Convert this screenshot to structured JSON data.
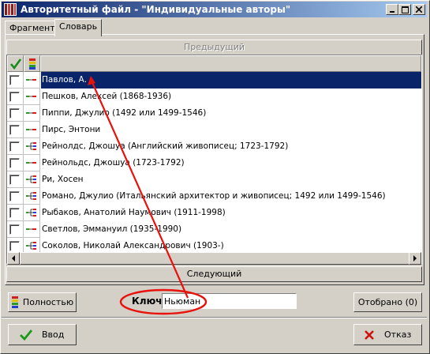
{
  "window": {
    "title": "Авторитетный файл - \"Индивидуальные авторы\""
  },
  "tabs": [
    {
      "label": "Фрагмент",
      "active": false
    },
    {
      "label": "Словарь",
      "active": true
    }
  ],
  "nav": {
    "previous_label": "Предыдущий",
    "next_label": "Следующий"
  },
  "list": {
    "items": [
      {
        "name": "Павлов, А.",
        "icon": "single",
        "selected": true
      },
      {
        "name": "Пешков, Алексей (1868-1936)",
        "icon": "single"
      },
      {
        "name": "Пиппи, Джулио (1492 или 1499-1546)",
        "icon": "single"
      },
      {
        "name": "Пирс, Энтони",
        "icon": "single"
      },
      {
        "name": "Рейнолдс, Джошуа (Английский живописец; 1723-1792)",
        "icon": "tree"
      },
      {
        "name": "Рейнольдс, Джошуа (1723-1792)",
        "icon": "single"
      },
      {
        "name": "Ри, Хосен",
        "icon": "tree"
      },
      {
        "name": "Романо, Джулио (Итальянский архитектор и живописец; 1492 или 1499-1546)",
        "icon": "tree"
      },
      {
        "name": "Рыбаков, Анатолий Наумович (1911-1998)",
        "icon": "tree"
      },
      {
        "name": "Светлов, Эммануил (1935-1990)",
        "icon": "single"
      },
      {
        "name": "Соколов, Николай Александрович (1903-)",
        "icon": "tree"
      }
    ]
  },
  "footer": {
    "full_label": "Полностью",
    "key_label": "Ключ:",
    "key_value": "Ньюман",
    "selected_label": "Отобрано (0)",
    "ok_label": "Ввод",
    "cancel_label": "Отказ"
  },
  "colors": {
    "accent": "#0a246a",
    "annotation": "#e8120c"
  }
}
